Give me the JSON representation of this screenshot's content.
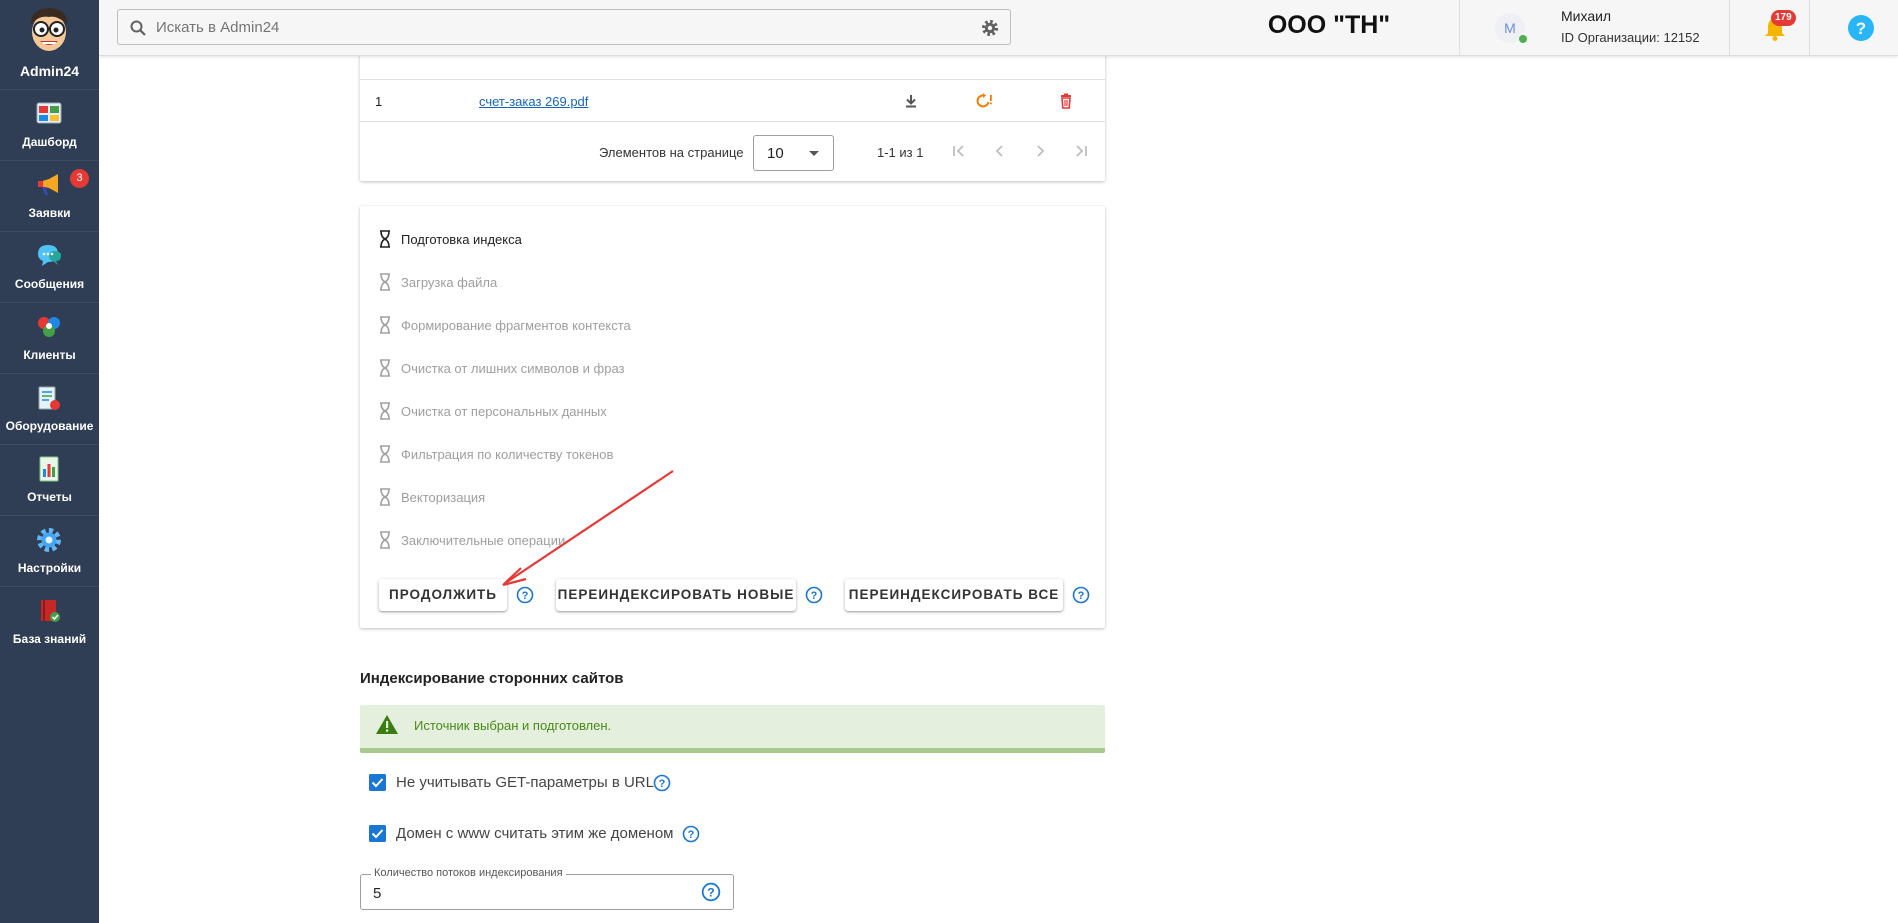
{
  "app": {
    "name": "Admin24"
  },
  "sidebar": {
    "items": [
      {
        "label": "Дашборд",
        "icon": "dashboard-icon",
        "badge": null
      },
      {
        "label": "Заявки",
        "icon": "megaphone-icon",
        "badge": "3"
      },
      {
        "label": "Сообщения",
        "icon": "chat-icon",
        "badge": null
      },
      {
        "label": "Клиенты",
        "icon": "clients-icon",
        "badge": null
      },
      {
        "label": "Оборудование",
        "icon": "equipment-icon",
        "badge": null
      },
      {
        "label": "Отчеты",
        "icon": "reports-icon",
        "badge": null
      },
      {
        "label": "Настройки",
        "icon": "settings-icon",
        "badge": null
      },
      {
        "label": "База знаний",
        "icon": "knowledge-base-icon",
        "badge": null
      }
    ]
  },
  "header": {
    "search_placeholder": "Искать в Admin24",
    "org_title": "ООО \"ТН\"",
    "user": {
      "initial": "М",
      "name": "Михаил",
      "org_id": "ID Организации: 12152"
    },
    "notifications_count": "179"
  },
  "files": {
    "rows": [
      {
        "num": "1",
        "name": "счет-заказ 269.pdf"
      }
    ],
    "pagination": {
      "items_per_page_label": "Элементов на странице",
      "page_size": "10",
      "range": "1-1 из 1"
    }
  },
  "indexing": {
    "steps": [
      {
        "label": "Подготовка индекса",
        "state": "active"
      },
      {
        "label": "Загрузка файла",
        "state": "pending"
      },
      {
        "label": "Формирование фрагментов контекста",
        "state": "pending"
      },
      {
        "label": "Очистка от лишних символов и фраз",
        "state": "pending"
      },
      {
        "label": "Очистка от персональных данных",
        "state": "pending"
      },
      {
        "label": "Фильтрация по количеству токенов",
        "state": "pending"
      },
      {
        "label": "Векторизация",
        "state": "pending"
      },
      {
        "label": "Заключительные операции",
        "state": "pending"
      }
    ],
    "buttons": {
      "continue": "ПРОДОЛЖИТЬ",
      "reindex_new": "ПЕРЕИНДЕКСИРОВАТЬ НОВЫЕ",
      "reindex_all": "ПЕРЕИНДЕКСИРОВАТЬ ВСЕ"
    }
  },
  "third_party": {
    "title": "Индексирование сторонних сайтов",
    "alert": "Источник выбран и подготовлен.",
    "ignore_get": {
      "label": "Не учитывать GET-параметры в URL",
      "checked": true
    },
    "www_same": {
      "label": "Домен с www считать этим же доменом",
      "checked": true
    },
    "threads": {
      "label": "Количество потоков индексирования",
      "value": "5"
    }
  },
  "colors": {
    "sidebar_bg": "#2f3e54",
    "accent": "#1976d2",
    "danger": "#e53935",
    "warning": "#f57c00",
    "success_text": "#4a8a18",
    "success_bg": "#e4efdd"
  }
}
